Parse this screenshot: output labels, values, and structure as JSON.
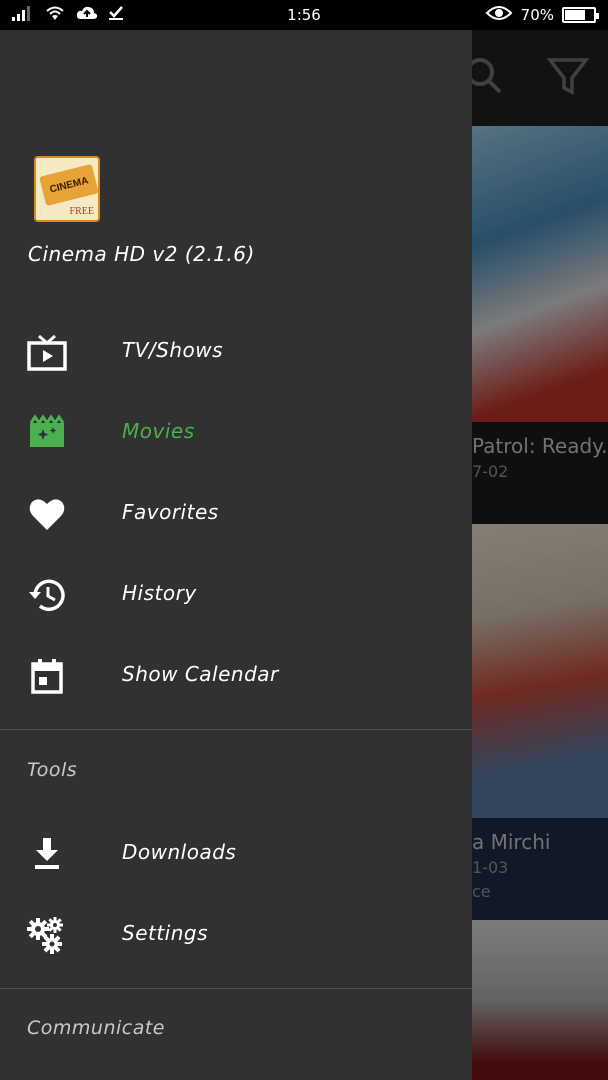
{
  "status_bar": {
    "time": "1:56",
    "battery": "70%",
    "battery_level": 0.7
  },
  "background": {
    "posters": [
      {
        "title": "Patrol: Ready...",
        "date": "7-02",
        "colors": [
          "#8cc2e0",
          "#d03a2c"
        ]
      },
      {
        "title": "a Mirchi",
        "date": "1-03",
        "extra": "ce",
        "colors": [
          "#e6ddd0",
          "#c74b3c"
        ]
      },
      {
        "title": "",
        "date": "",
        "colors": [
          "#dcdcdc",
          "#8a1a1a"
        ]
      }
    ]
  },
  "drawer": {
    "app_title": "Cinema HD v2 (2.1.6)",
    "logo_text": "CINEMA",
    "logo_free": "FREE",
    "items": [
      {
        "label": "TV/Shows",
        "icon": "tv-icon"
      },
      {
        "label": "Movies",
        "icon": "movie-clapper-icon",
        "active": true
      },
      {
        "label": "Favorites",
        "icon": "heart-icon"
      },
      {
        "label": "History",
        "icon": "history-icon"
      },
      {
        "label": "Show Calendar",
        "icon": "calendar-icon"
      }
    ],
    "tools_heading": "Tools",
    "tools": [
      {
        "label": "Downloads",
        "icon": "download-icon"
      },
      {
        "label": "Settings",
        "icon": "settings-gears-icon"
      }
    ],
    "communicate_heading": "Communicate"
  },
  "colors": {
    "drawer_bg": "#313131",
    "active": "#4caf50"
  }
}
